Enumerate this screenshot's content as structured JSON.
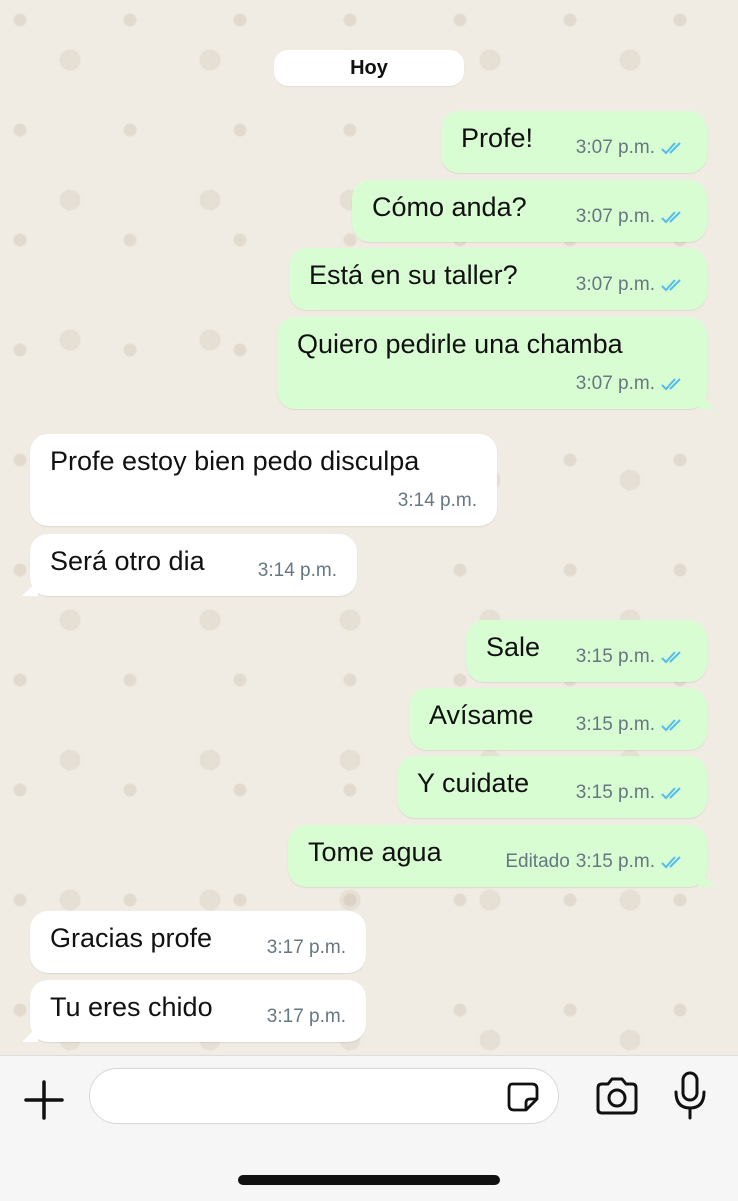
{
  "chat": {
    "date_label": "Hoy",
    "messages": [
      {
        "text": "Profe!",
        "time": "3:07 p.m.",
        "direction": "out",
        "status": "read"
      },
      {
        "text": "Cómo anda?",
        "time": "3:07 p.m.",
        "direction": "out",
        "status": "read"
      },
      {
        "text": "Está en su taller?",
        "time": "3:07 p.m.",
        "direction": "out",
        "status": "read"
      },
      {
        "text": "Quiero pedirle una chamba",
        "time": "3:07 p.m.",
        "direction": "out",
        "status": "read"
      },
      {
        "text": "Profe estoy bien pedo disculpa",
        "time": "3:14 p.m.",
        "direction": "in"
      },
      {
        "text": "Será otro dia",
        "time": "3:14 p.m.",
        "direction": "in"
      },
      {
        "text": "Sale",
        "time": "3:15 p.m.",
        "direction": "out",
        "status": "read"
      },
      {
        "text": "Avísame",
        "time": "3:15 p.m.",
        "direction": "out",
        "status": "read"
      },
      {
        "text": "Y cuidate",
        "time": "3:15 p.m.",
        "direction": "out",
        "status": "read"
      },
      {
        "text": "Tome agua",
        "time": "3:15 p.m.",
        "edited_label": "Editado",
        "direction": "out",
        "status": "read"
      },
      {
        "text": "Gracias profe",
        "time": "3:17 p.m.",
        "direction": "in"
      },
      {
        "text": "Tu eres chido",
        "time": "3:17 p.m.",
        "direction": "in"
      }
    ]
  },
  "input_bar": {
    "placeholder": "",
    "icons": [
      "plus-icon",
      "sticker-icon",
      "camera-icon",
      "microphone-icon"
    ]
  },
  "colors": {
    "outgoing_bubble": "#d9fdd3",
    "incoming_bubble": "#ffffff",
    "read_ticks": "#53bdeb",
    "chat_background": "#f0ebe3"
  }
}
